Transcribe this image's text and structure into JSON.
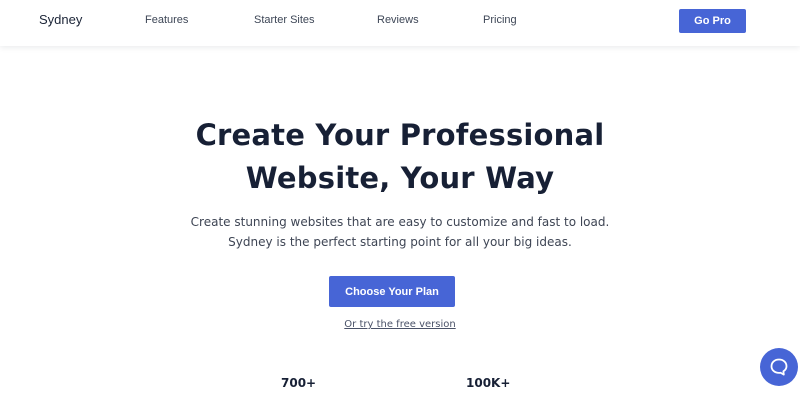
{
  "header": {
    "logo": "Sydney",
    "nav": [
      "Features",
      "Starter Sites",
      "Reviews",
      "Pricing"
    ],
    "cta_label": "Go Pro"
  },
  "hero": {
    "title_lines": [
      "Create Your Professional",
      "Website, Your Way"
    ],
    "subtitle_lines": [
      "Create stunning websites that are easy to customize and fast to load.",
      "Sydney is the perfect starting point for all your big ideas."
    ],
    "cta_label": "Choose Your Plan",
    "secondary_link": "Or try the free version"
  },
  "stats": [
    "700+",
    "100K+"
  ],
  "help_widget": {
    "icon": "chat-bubble-icon"
  },
  "colors": {
    "accent": "#4765d6",
    "text_dark": "#172035"
  }
}
